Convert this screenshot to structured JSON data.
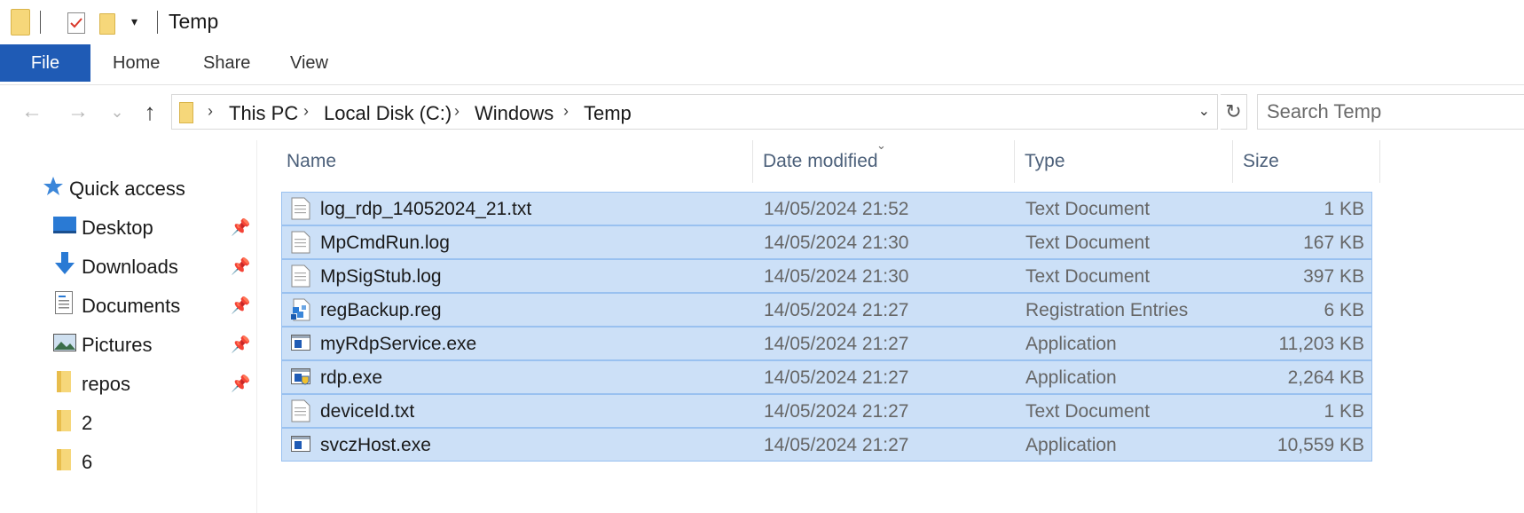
{
  "window": {
    "title": "Temp"
  },
  "quick_toolbar": {
    "icons": [
      "folder-icon",
      "properties-icon",
      "new-folder-icon",
      "customize-dropdown-icon"
    ],
    "dropdown_glyph": "▾"
  },
  "ribbon": {
    "tabs": [
      {
        "label": "File",
        "active": true
      },
      {
        "label": "Home"
      },
      {
        "label": "Share"
      },
      {
        "label": "View"
      }
    ]
  },
  "navigation": {
    "back_glyph": "←",
    "forward_glyph": "→",
    "recent_glyph": "⌄",
    "up_glyph": "↑",
    "breadcrumb": [
      "This PC",
      "Local Disk (C:)",
      "Windows",
      "Temp"
    ],
    "separator_glyph": "›",
    "dropdown_glyph": "⌄",
    "refresh_glyph": "↻",
    "search_placeholder": "Search Temp"
  },
  "sidebar": {
    "pin_glyph": "📌",
    "items": [
      {
        "label": "Quick access",
        "icon": "star-icon",
        "pinned": false
      },
      {
        "label": "Desktop",
        "icon": "desktop-icon",
        "pinned": true
      },
      {
        "label": "Downloads",
        "icon": "download-icon",
        "pinned": true
      },
      {
        "label": "Documents",
        "icon": "document-icon",
        "pinned": true
      },
      {
        "label": "Pictures",
        "icon": "pictures-icon",
        "pinned": true
      },
      {
        "label": "repos",
        "icon": "folder-icon",
        "pinned": true
      },
      {
        "label": "2",
        "icon": "folder-icon",
        "pinned": false
      },
      {
        "label": "6",
        "icon": "folder-icon",
        "pinned": false
      }
    ]
  },
  "file_list": {
    "columns": {
      "name": "Name",
      "date": "Date modified",
      "type": "Type",
      "size": "Size"
    },
    "sort_glyph": "⌄",
    "files": [
      {
        "name": "log_rdp_14052024_21.txt",
        "date": "14/05/2024 21:52",
        "type": "Text Document",
        "size": "1 KB",
        "icon": "text-file-icon"
      },
      {
        "name": "MpCmdRun.log",
        "date": "14/05/2024 21:30",
        "type": "Text Document",
        "size": "167 KB",
        "icon": "text-file-icon"
      },
      {
        "name": "MpSigStub.log",
        "date": "14/05/2024 21:30",
        "type": "Text Document",
        "size": "397 KB",
        "icon": "text-file-icon"
      },
      {
        "name": "regBackup.reg",
        "date": "14/05/2024 21:27",
        "type": "Registration Entries",
        "size": "6 KB",
        "icon": "registry-file-icon"
      },
      {
        "name": "myRdpService.exe",
        "date": "14/05/2024 21:27",
        "type": "Application",
        "size": "11,203 KB",
        "icon": "application-icon"
      },
      {
        "name": "rdp.exe",
        "date": "14/05/2024 21:27",
        "type": "Application",
        "size": "2,264 KB",
        "icon": "application-shield-icon"
      },
      {
        "name": "deviceId.txt",
        "date": "14/05/2024 21:27",
        "type": "Text Document",
        "size": "1 KB",
        "icon": "text-file-icon"
      },
      {
        "name": "svczHost.exe",
        "date": "14/05/2024 21:27",
        "type": "Application",
        "size": "10,559 KB",
        "icon": "application-icon"
      }
    ]
  },
  "colors": {
    "accent": "#1f5bb5",
    "selection_fill": "#cce0f7",
    "selection_border": "#99c1f0",
    "folder": "#f6d77a"
  }
}
